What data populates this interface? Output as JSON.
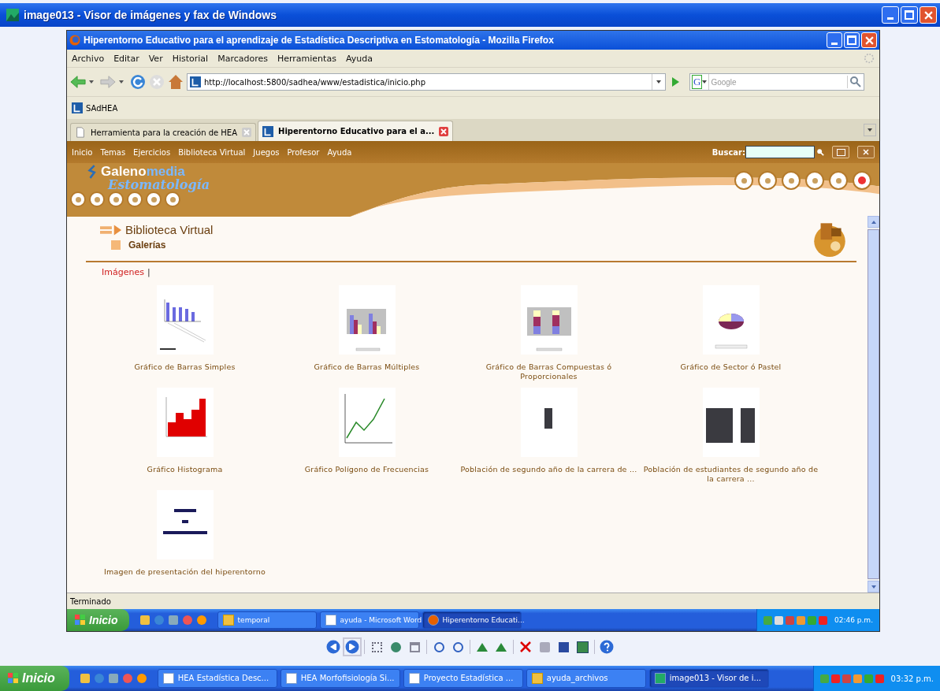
{
  "viewer": {
    "title": "image013 - Visor de imágenes y fax de Windows"
  },
  "browser": {
    "title": "Hiperentorno Educativo para el aprendizaje de Estadística Descriptiva en Estomatología - Mozilla Firefox",
    "menu": [
      "Archivo",
      "Editar",
      "Ver",
      "Historial",
      "Marcadores",
      "Herramientas",
      "Ayuda"
    ],
    "url": "http://localhost:5800/sadhea/www/estadistica/inicio.php",
    "search_engine": "G",
    "search_placeholder": "Google",
    "bookmarks": [
      "SAdHEA"
    ],
    "tabs": [
      {
        "label": "Herramienta para la creación de HEA",
        "selected": false
      },
      {
        "label": "Hiperentorno Educativo para el a...",
        "selected": true
      }
    ],
    "status": "Terminado"
  },
  "site": {
    "nav": [
      "Inicio",
      "Temas",
      "Ejercicios",
      "Biblioteca Virtual",
      "Juegos",
      "Profesor",
      "Ayuda"
    ],
    "search_label": "Buscar:",
    "logo_main": "Galeno",
    "logo_accent": "media",
    "logo_sub": "Estomatología",
    "section": "Biblioteca Virtual",
    "subsection": "Galerías",
    "filter_link": "Imágenes",
    "filter_sep": "|",
    "gallery": [
      {
        "caption": "Gráfico de Barras Simples",
        "kind": "bars"
      },
      {
        "caption": "Gráfico de Barras Múltiples",
        "kind": "multibars"
      },
      {
        "caption": "Gráfico de Barras Compuestas ó Proporcionales",
        "kind": "stacked"
      },
      {
        "caption": "Gráfico de Sector ó Pastel",
        "kind": "pie"
      },
      {
        "caption": "Gráfico Histograma",
        "kind": "histogram"
      },
      {
        "caption": "Gráfico Polígono de Frecuencias",
        "kind": "line"
      },
      {
        "caption": "Población de segundo año de la carrera de ...",
        "kind": "photo"
      },
      {
        "caption": "Población de estudiantes de segundo año de la carrera ...",
        "kind": "photos"
      },
      {
        "caption": "Imagen de presentación del hiperentorno",
        "kind": "title"
      }
    ]
  },
  "inner_taskbar": {
    "start": "Inicio",
    "items": [
      {
        "label": "temporal",
        "kind": "folder",
        "selected": false
      },
      {
        "label": "ayuda - Microsoft Word",
        "kind": "word",
        "selected": false
      },
      {
        "label": "Hiperentorno Educati...",
        "kind": "firefox",
        "selected": true
      }
    ],
    "clock": "02:46 p.m."
  },
  "outer_taskbar": {
    "start": "Inicio",
    "items": [
      {
        "label": "HEA  Estadística Desc...",
        "kind": "word",
        "selected": false
      },
      {
        "label": "HEA Morfofisiología Si...",
        "kind": "word",
        "selected": false
      },
      {
        "label": "Proyecto Estadística ...",
        "kind": "word",
        "selected": false
      },
      {
        "label": "ayuda_archivos",
        "kind": "folder",
        "selected": false
      },
      {
        "label": "image013 - Visor de i...",
        "kind": "image",
        "selected": true
      }
    ],
    "clock": "03:32 p.m."
  }
}
